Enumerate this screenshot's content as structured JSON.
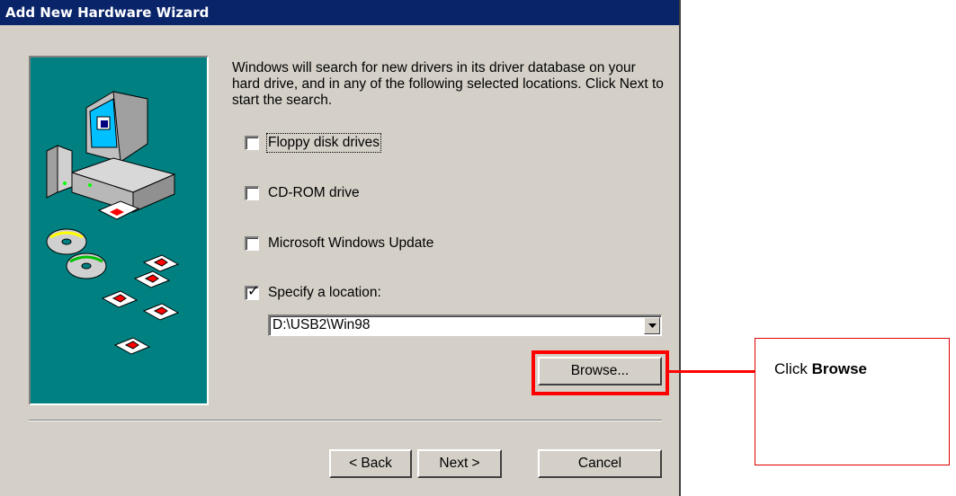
{
  "window": {
    "title": "Add New Hardware Wizard"
  },
  "intro_text": "Windows will search for new drivers in its driver database on your hard drive, and in any of the following selected locations. Click Next to start the search.",
  "options": [
    {
      "label": "Floppy disk drives",
      "checked": false
    },
    {
      "label": "CD-ROM drive",
      "checked": false
    },
    {
      "label": "Microsoft Windows Update",
      "checked": false
    },
    {
      "label": "Specify a location:",
      "checked": true
    }
  ],
  "location": {
    "value": "D:\\USB2\\Win98"
  },
  "buttons": {
    "browse": "Browse...",
    "back": "< Back",
    "next": "Next >",
    "cancel": "Cancel"
  },
  "annotation": {
    "prefix": "Click ",
    "emphasis": "Browse",
    "highlight_color": "#ff0000"
  },
  "colors": {
    "title_bar": "#0a246a",
    "dialog_face": "#d4d0c8",
    "art_background": "#008080"
  }
}
